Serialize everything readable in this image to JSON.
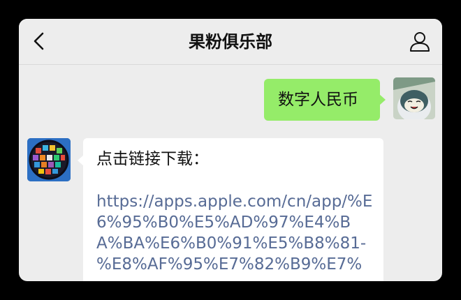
{
  "header": {
    "title": "果粉俱乐部",
    "back_icon": "chevron-left-icon",
    "profile_icon": "person-icon"
  },
  "messages": [
    {
      "sender": "me",
      "text": "数字人民币"
    },
    {
      "sender": "contact",
      "text": "点击链接下载：",
      "link": "https://apps.apple.com/cn/app/%E6%95%B0%E5%AD%97%E4%BA%BA%E6%B0%91%E5%B8%81-%E8%AF%95%E7%82%B9%E7%"
    }
  ],
  "colors": {
    "background": "#ededed",
    "sent_bubble": "#95ec69",
    "received_bubble": "#ffffff",
    "link": "#576b95"
  }
}
